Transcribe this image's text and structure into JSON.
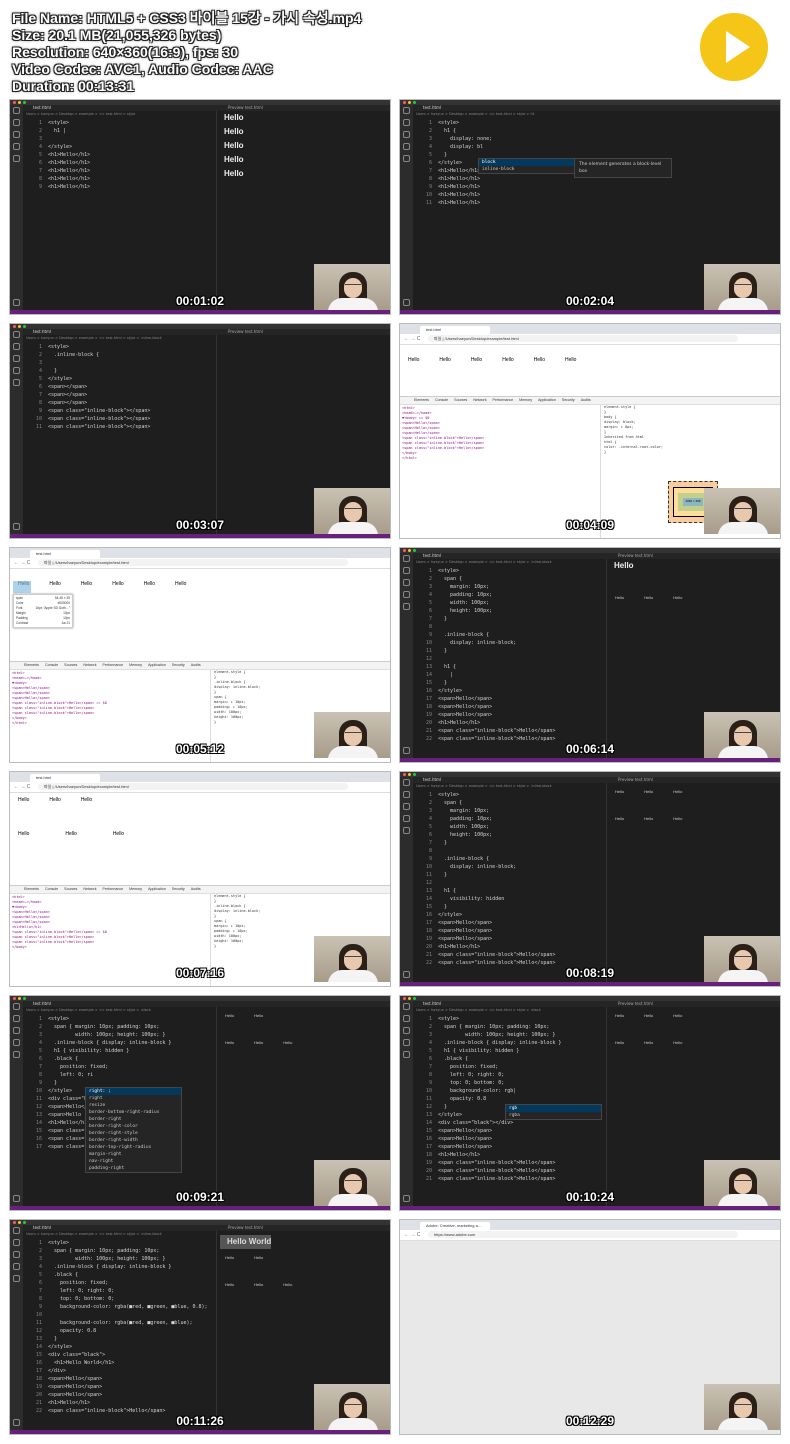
{
  "info": {
    "lines": [
      "File Name: HTML5 + CSS3 바이블 15강 - 가시 속성.mp4",
      "Size: 20.1 MB(21,055,326 bytes)",
      "Resolution: 640×360(16:9), fps: 30",
      "Video Codec: AVC1, Audio Codec: AAC",
      "Duration: 00:13:31"
    ]
  },
  "thumbs": [
    {
      "time": "00:01:02",
      "tab": "test.html",
      "preview_tab": "Preview test.html",
      "breadcrumb": "Users > haeyun > Desktop > example > <> test.html > style",
      "code": [
        "<style>",
        "  h1 |",
        "",
        "</style>",
        "<h1>Hello</h1>",
        "<h1>Hello</h1>",
        "<h1>Hello</h1>",
        "<h1>Hello</h1>",
        "<h1>Hello</h1>"
      ],
      "preview": [
        "Hello",
        "Hello",
        "Hello",
        "Hello",
        "Hello"
      ]
    },
    {
      "time": "00:02:04",
      "tab": "test.html",
      "breadcrumb": "Users > haeyun > Desktop > example > <> test.html > style > h1",
      "code": [
        "<style>",
        "  h1 {",
        "    display: none;",
        "    display: bl",
        "  }",
        "</style>",
        "<h1>Hello</h1>",
        "<h1>Hello</h1>",
        "<h1>Hello</h1>",
        "<h1>Hello</h1>",
        "<h1>Hello</h1>"
      ],
      "autocomplete": [
        "block",
        "inline-block"
      ],
      "autocomplete_doc": "The element generates a block-level box"
    },
    {
      "time": "00:03:07",
      "tab": "test.html",
      "preview_tab": "Preview test.html",
      "breadcrumb": "Users > haeyun > Desktop > example > <> test.html > style > .inline-block",
      "code": [
        "<style>",
        "  .inline-block {",
        "",
        "  }",
        "</style>",
        "<span></span>",
        "<span></span>",
        "<span></span>",
        "<span class=\"inline-block\"></span>",
        "<span class=\"inline-block\"></span>",
        "<span class=\"inline-block\"></span>"
      ]
    },
    {
      "time": "00:04:09",
      "tab": "test.html",
      "url": "파일 | /Users/haeyun/Desktop/example/test.html",
      "page_hello": [
        "Hello",
        "Hello",
        "Hello",
        "Hello",
        "Hello",
        "Hello"
      ],
      "dev_tabs": [
        "Elements",
        "Console",
        "Sources",
        "Network",
        "Performance",
        "Memory",
        "Application",
        "Security",
        "Audits"
      ],
      "elements": [
        "<html>",
        " <head>…</head>",
        " ▼<body> == $0",
        "   <span>Hello</span>",
        "   <span>Hello</span>",
        "   <span>Hello</span>",
        "   <span class=\"inline-block\">Hello</span>",
        "   <span class=\"inline-block\">Hello</span>",
        "   <span class=\"inline-block\">Hello</span>",
        " </body>",
        "</html>"
      ],
      "styles": [
        "element.style {",
        "}",
        "body {",
        "  display: block;",
        "  margin: ▸ 8px;",
        "}",
        "Inherited from html",
        "html {",
        "  color: -internal-root-color;",
        "}"
      ],
      "box_content": "1084 × 356"
    },
    {
      "time": "00:05:12",
      "tab": "test.html",
      "url": "파일 | /Users/haeyun/Desktop/example/test.html",
      "page_hello": [
        "Hello",
        "Hello",
        "Hello",
        "Hello",
        "Hello",
        "Hello"
      ],
      "tooltip": [
        "span",
        "Color",
        "Font",
        "Margin",
        "Padding",
        "Contrast"
      ],
      "tooltip_vals": [
        "54.48 × 39",
        "#000000",
        "16px \"Apple SD Goth…\"",
        "10px",
        "10px",
        "Aa 21"
      ],
      "elements": [
        "<html>",
        " <head>…</head>",
        " ▼<body>",
        "   <span>Hello</span>",
        "   <span>Hello</span>",
        "   <span>Hello</span>",
        "   <span class=\"inline-block\">Hello</span> == $0",
        "   <span class=\"inline-block\">Hello</span>",
        "   <span class=\"inline-block\">Hello</span>",
        " </body>",
        "</html>"
      ],
      "styles": [
        "element.style {",
        "}",
        ".inline-block {",
        "  display: inline-block;",
        "}",
        "span {",
        "  margin: ▸ 10px;",
        "  padding: ▸ 10px;",
        "  width: 100px;",
        "  height: 100px;",
        "}"
      ]
    },
    {
      "time": "00:06:14",
      "tab": "test.html",
      "preview_tab": "Preview test.html",
      "breadcrumb": "Users > haeyun > Desktop > example > <> test.html > style > .inline-block",
      "code": [
        "<style>",
        "  span {",
        "    margin: 10px;",
        "    padding: 10px;",
        "    width: 100px;",
        "    height: 100px;",
        "  }",
        "",
        "  .inline-block {",
        "    display: inline-block;",
        "  }",
        "",
        "  h1 {",
        "    |",
        "  }",
        "</style>",
        "<span>Hello</span>",
        "<span>Hello</span>",
        "<span>Hello</span>",
        "<h1>Hello</h1>",
        "<span class=\"inline-block\">Hello</span>",
        "<span class=\"inline-block\">Hello</span>"
      ],
      "preview_h1": "Hello",
      "preview_inline": [
        "Hello",
        "Hello",
        "Hello"
      ]
    },
    {
      "time": "00:07:16",
      "tab": "test.html",
      "url": "파일 | /Users/haeyun/Desktop/example/test.html",
      "page_hello": [
        "Hello",
        "Hello",
        "Hello"
      ],
      "page_hello2": [
        "Hello",
        "Hello",
        "Hello"
      ],
      "elements": [
        "<html>",
        " <head>…</head>",
        " ▼<body>",
        "   <span>Hello</span>",
        "   <span>Hello</span>",
        "   <span>Hello</span>",
        "   <h1>Hello</h1>",
        "   <span class=\"inline-block\">Hello</span> == $0",
        "   <span class=\"inline-block\">Hello</span>",
        "   <span class=\"inline-block\">Hello</span>",
        " </body>"
      ],
      "styles": [
        "element.style {",
        "}",
        ".inline-block {",
        "  display: inline-block;",
        "}",
        "span {",
        "  margin: ▸ 10px;",
        "  padding: ▸ 10px;",
        "  width: 100px;",
        "  height: 100px;",
        "}"
      ]
    },
    {
      "time": "00:08:19",
      "tab": "test.html",
      "preview_tab": "Preview test.html",
      "breadcrumb": "Users > haeyun > Desktop > example > <> test.html > style > .inline-block",
      "code": [
        "<style>",
        "  span {",
        "    margin: 10px;",
        "    padding: 10px;",
        "    width: 100px;",
        "    height: 100px;",
        "  }",
        "",
        "  .inline-block {",
        "    display: inline-block;",
        "  }",
        "",
        "  h1 {",
        "    visibility: hidden",
        "  }",
        "</style>",
        "<span>Hello</span>",
        "<span>Hello</span>",
        "<span>Hello</span>",
        "<h1>Hello</h1>",
        "<span class=\"inline-block\">Hello</span>",
        "<span class=\"inline-block\">Hello</span>"
      ],
      "preview_top": [
        "Hello",
        "Hello",
        "Hello"
      ],
      "preview_inline": [
        "Hello",
        "Hello",
        "Hello"
      ]
    },
    {
      "time": "00:09:21",
      "tab": "test.html",
      "breadcrumb": "Users > haeyun > Desktop > example > <> test.html > style > .black",
      "code": [
        "<style>",
        "  span { margin: 10px; padding: 10px;",
        "         width: 100px; height: 100px; }",
        "  .inline-block { display: inline-block }",
        "  h1 { visibility: hidden }",
        "  .black {",
        "    position: fixed;",
        "    left: 0; ri",
        "  }",
        "</style>",
        "<div class=\"bl",
        "<span>Hello</span>",
        "<span>Hello",
        "<h1>Hello</h1>",
        "<span class=\"in",
        "<span class=\"in",
        "<span class=\"in"
      ],
      "autocomplete": [
        "right: ;",
        "right",
        "resize",
        "border-bottom-right-radius",
        "border-right",
        "border-right-color",
        "border-right-style",
        "border-right-width",
        "border-top-right-radius",
        "margin-right",
        "nav-right",
        "padding-right"
      ],
      "preview_top": [
        "Hello",
        "Hello"
      ],
      "preview_inline": [
        "Hello",
        "Hello",
        "Hello"
      ]
    },
    {
      "time": "00:10:24",
      "tab": "test.html",
      "preview_tab": "Preview test.html",
      "breadcrumb": "Users > haeyun > Desktop > example > <> test.html > style > .black",
      "code": [
        "<style>",
        "  span { margin: 10px; padding: 10px;",
        "         width: 100px; height: 100px; }",
        "  .inline-block { display: inline-block }",
        "  h1 { visibility: hidden }",
        "  .black {",
        "    position: fixed;",
        "    left: 0; right: 0;",
        "    top: 0; bottom: 0;",
        "    background-color: rgb|",
        "    opacity: 0.8",
        "  }",
        "</style>",
        "<div class=\"black\"></div>",
        "<span>Hello</span>",
        "<span>Hello</span>",
        "<span>Hello</span>",
        "<h1>Hello</h1>",
        "<span class=\"inline-block\">Hello</span>",
        "<span class=\"inline-block\">Hello</span>",
        "<span class=\"inline-block\">Hello</span>"
      ],
      "autocomplete": [
        "rgb",
        "rgba"
      ],
      "preview_top": [
        "Hello",
        "Hello",
        "Hello"
      ],
      "preview_inline": [
        "Hello",
        "Hello",
        "Hello"
      ]
    },
    {
      "time": "00:11:26",
      "tab": "test.html",
      "preview_tab": "Preview test.html",
      "breadcrumb": "Users > haeyun > Desktop > example > <> test.html > style > .inline-block",
      "code": [
        "<style>",
        "  span { margin: 10px; padding: 10px;",
        "         width: 100px; height: 100px; }",
        "  .inline-block { display: inline-block }",
        "  .black {",
        "    position: fixed;",
        "    left: 0; right: 0;",
        "    top: 0; bottom: 0;",
        "    background-color: rgba(■red, ■green, ■blue, 0.8);",
        "",
        "    background-color: rgba(■red, ■green, ■blue);",
        "    opacity: 0.8",
        "  }",
        "</style>",
        "<div class=\"black\">",
        "  <h1>Hello World</h1>",
        "</div>",
        "<span>Hello</span>",
        "<span>Hello</span>",
        "<span>Hello</span>",
        "<h1>Hello</h1>",
        "<span class=\"inline-block\">Hello</span>"
      ],
      "preview_overlay": "Hello World",
      "preview_top": [
        "Hello",
        "Hello"
      ],
      "preview_inline": [
        "Hello",
        "Hello",
        "Hello"
      ]
    },
    {
      "time": "00:12:29",
      "tab": "Adobe: Creative, marketing a…",
      "url": "https://www.adobe.com"
    }
  ]
}
